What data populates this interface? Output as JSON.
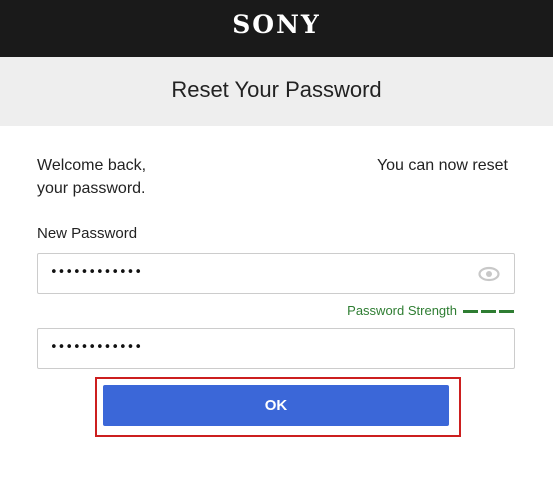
{
  "brand": {
    "logo_text": "SONY"
  },
  "header": {
    "title": "Reset Your Password"
  },
  "intro": {
    "left_text_line1": "Welcome back,",
    "left_text_line2": "your password.",
    "right_text": "You can now reset"
  },
  "form": {
    "new_password_label": "New Password",
    "new_password_value": "••••••••••••",
    "confirm_password_value": "••••••••••••",
    "strength_label": "Password Strength",
    "strength_level": 3,
    "strength_max": 3,
    "ok_label": "OK"
  },
  "colors": {
    "topbar": "#1a1a1a",
    "header_bg": "#eeeeee",
    "button": "#3b67d8",
    "strength": "#2e7d32",
    "highlight_frame": "#cc1f1f"
  },
  "icons": {
    "show_password": "eye-icon"
  }
}
